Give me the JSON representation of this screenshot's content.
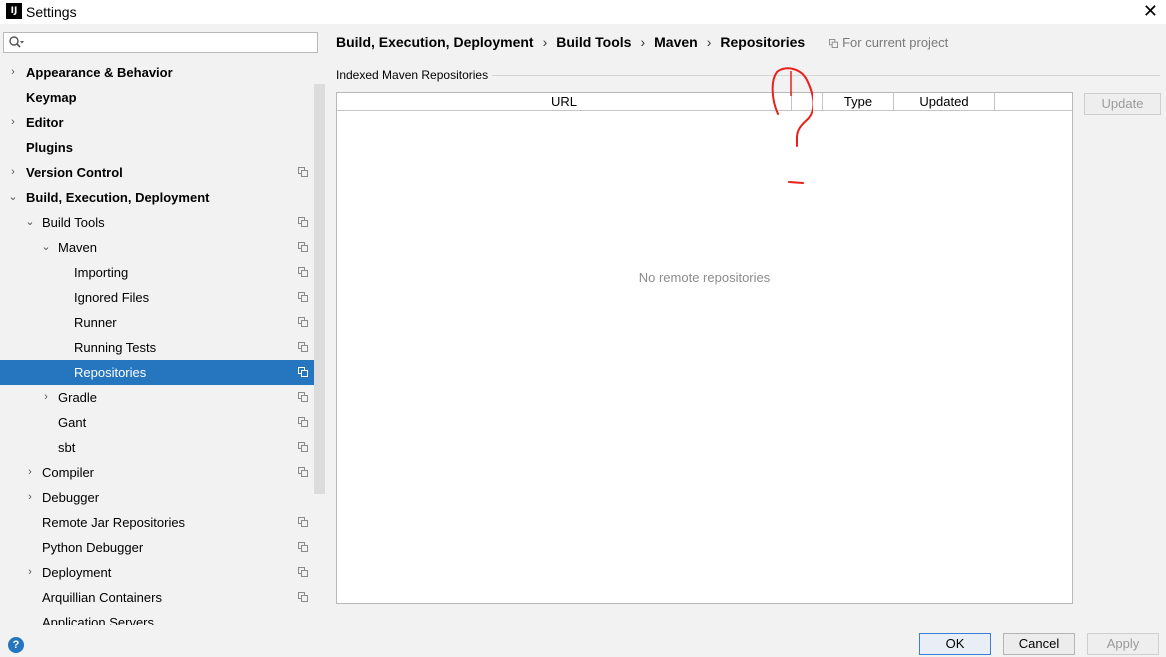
{
  "window": {
    "app_icon": "IJ",
    "title": "Settings",
    "close": "✕"
  },
  "search": {
    "placeholder": "",
    "icon": "search-icon"
  },
  "tree": [
    {
      "label": "Appearance & Behavior",
      "arrow": "›",
      "bold": true,
      "level": 0,
      "copy": false
    },
    {
      "label": "Keymap",
      "arrow": "",
      "bold": true,
      "level": 0,
      "copy": false
    },
    {
      "label": "Editor",
      "arrow": "›",
      "bold": true,
      "level": 0,
      "copy": false
    },
    {
      "label": "Plugins",
      "arrow": "",
      "bold": true,
      "level": 0,
      "copy": false
    },
    {
      "label": "Version Control",
      "arrow": "›",
      "bold": true,
      "level": 0,
      "copy": true
    },
    {
      "label": "Build, Execution, Deployment",
      "arrow": "⌄",
      "bold": true,
      "level": 0,
      "copy": false
    },
    {
      "label": "Build Tools",
      "arrow": "⌄",
      "bold": false,
      "level": 1,
      "copy": true
    },
    {
      "label": "Maven",
      "arrow": "⌄",
      "bold": false,
      "level": 2,
      "copy": true
    },
    {
      "label": "Importing",
      "arrow": "",
      "bold": false,
      "level": 3,
      "copy": true
    },
    {
      "label": "Ignored Files",
      "arrow": "",
      "bold": false,
      "level": 3,
      "copy": true
    },
    {
      "label": "Runner",
      "arrow": "",
      "bold": false,
      "level": 3,
      "copy": true
    },
    {
      "label": "Running Tests",
      "arrow": "",
      "bold": false,
      "level": 3,
      "copy": true
    },
    {
      "label": "Repositories",
      "arrow": "",
      "bold": false,
      "level": 3,
      "copy": true,
      "selected": true
    },
    {
      "label": "Gradle",
      "arrow": "›",
      "bold": false,
      "level": 2,
      "copy": true
    },
    {
      "label": "Gant",
      "arrow": "",
      "bold": false,
      "level": 2,
      "copy": true
    },
    {
      "label": "sbt",
      "arrow": "",
      "bold": false,
      "level": 2,
      "copy": true
    },
    {
      "label": "Compiler",
      "arrow": "›",
      "bold": false,
      "level": 1,
      "copy": true
    },
    {
      "label": "Debugger",
      "arrow": "›",
      "bold": false,
      "level": 1,
      "copy": false
    },
    {
      "label": "Remote Jar Repositories",
      "arrow": "",
      "bold": false,
      "level": 1,
      "copy": true
    },
    {
      "label": "Python Debugger",
      "arrow": "",
      "bold": false,
      "level": 1,
      "copy": true
    },
    {
      "label": "Deployment",
      "arrow": "›",
      "bold": false,
      "level": 1,
      "copy": true
    },
    {
      "label": "Arquillian Containers",
      "arrow": "",
      "bold": false,
      "level": 1,
      "copy": true
    },
    {
      "label": "Application Servers",
      "arrow": "",
      "bold": false,
      "level": 1,
      "copy": false
    }
  ],
  "breadcrumb": {
    "parts": [
      "Build, Execution, Deployment",
      "Build Tools",
      "Maven",
      "Repositories"
    ],
    "separator": "›",
    "scope": "For current project"
  },
  "group": {
    "title": "Indexed Maven Repositories"
  },
  "table": {
    "columns": [
      "URL",
      "",
      "Type",
      "Updated",
      ""
    ],
    "empty_text": "No remote repositories"
  },
  "buttons": {
    "update": "Update",
    "ok": "OK",
    "cancel": "Cancel",
    "apply": "Apply",
    "help": "?"
  },
  "colors": {
    "selection": "#2675bf",
    "annotation": "#e8221b"
  }
}
